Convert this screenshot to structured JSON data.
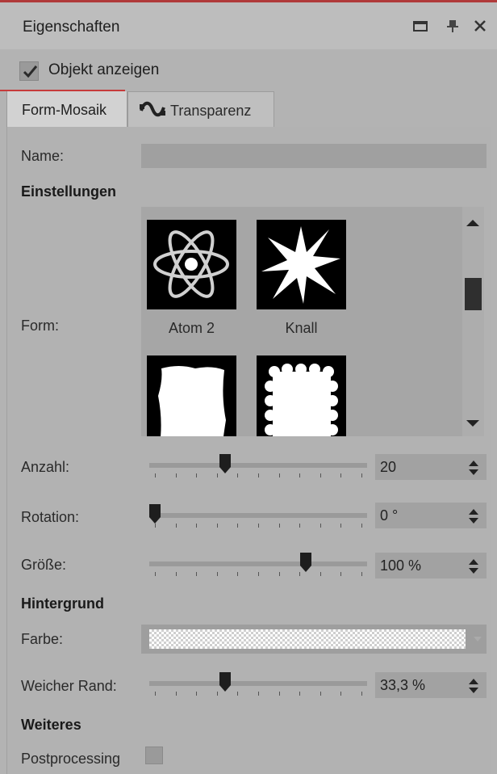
{
  "window": {
    "title": "Eigenschaften",
    "controls": [
      "maximize-icon",
      "pin-icon",
      "close-icon"
    ]
  },
  "show_object": {
    "label": "Objekt anzeigen",
    "checked": true
  },
  "tabs": [
    {
      "label": "Form-Mosaik",
      "active": true
    },
    {
      "label": "Transparenz",
      "active": false,
      "icon": "transparency-icon"
    }
  ],
  "name_field": {
    "label": "Name:",
    "value": ""
  },
  "settings": {
    "heading": "Einstellungen",
    "form_label": "Form:",
    "shapes": [
      {
        "label": "Atom 2",
        "icon": "atom-icon"
      },
      {
        "label": "Knall",
        "icon": "burst-icon"
      },
      {
        "label": "",
        "icon": "rough-rectangle-icon"
      },
      {
        "label": "",
        "icon": "scalloped-rectangle-icon"
      }
    ],
    "sliders": [
      {
        "label": "Anzahl:",
        "value": "20",
        "position": 0.34
      },
      {
        "label": "Rotation:",
        "value": "0 °",
        "position": 0.0
      },
      {
        "label": "Größe:",
        "value": "100 %",
        "position": 0.73
      }
    ]
  },
  "background": {
    "heading": "Hintergrund",
    "color_label": "Farbe:",
    "color_value": "transparent",
    "soft_edge": {
      "label": "Weicher Rand:",
      "value": "33,3 %",
      "position": 0.34
    }
  },
  "more": {
    "heading": "Weiteres",
    "postprocessing": {
      "label": "Postprocessing",
      "checked": false
    }
  },
  "colors": {
    "accent": "#c63b3b",
    "panel": "#b2b2b2"
  }
}
